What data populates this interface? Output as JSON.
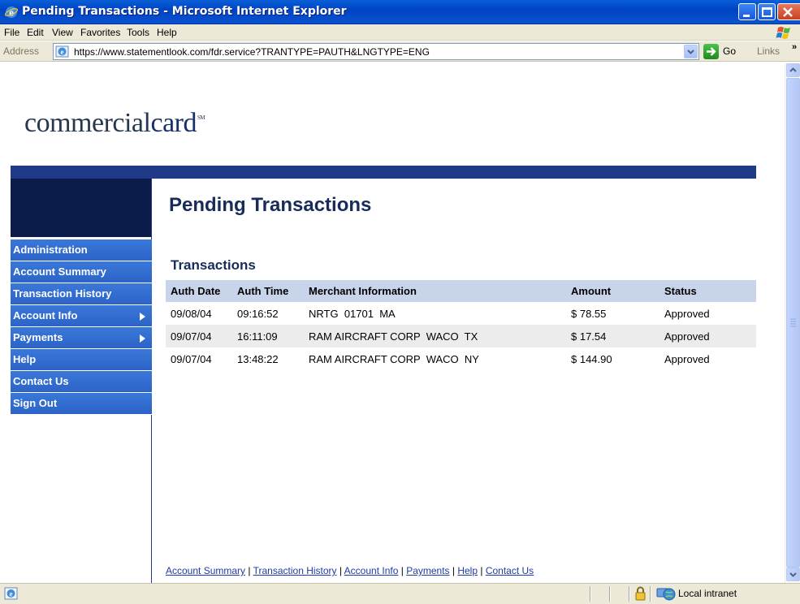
{
  "window": {
    "title": "Pending Transactions - Microsoft Internet Explorer"
  },
  "menu": {
    "file": "File",
    "edit": "Edit",
    "view": "View",
    "favorites": "Favorites",
    "tools": "Tools",
    "help": "Help"
  },
  "address_bar": {
    "label": "Address",
    "url": "https://www.statementlook.com/fdr.service?TRANTYPE=PAUTH&LNGTYPE=ENG",
    "go_label": "Go",
    "links_label": "Links",
    "links_chevron": "»"
  },
  "page": {
    "logo_part1": "commercial",
    "logo_part2": "card",
    "logo_mark": "SM",
    "title": "Pending Transactions",
    "section_title": "Transactions"
  },
  "sidenav": {
    "items": [
      {
        "label": "Administration",
        "has_submenu": false
      },
      {
        "label": "Account Summary",
        "has_submenu": false
      },
      {
        "label": "Transaction History",
        "has_submenu": false
      },
      {
        "label": "Account Info",
        "has_submenu": true
      },
      {
        "label": "Payments",
        "has_submenu": true
      },
      {
        "label": "Help",
        "has_submenu": false
      },
      {
        "label": "Contact Us",
        "has_submenu": false
      },
      {
        "label": "Sign Out",
        "has_submenu": false
      }
    ]
  },
  "transactions": {
    "columns": [
      "Auth Date",
      "Auth Time",
      "Merchant Information",
      "Amount",
      "Status"
    ],
    "rows": [
      [
        "09/08/04",
        "09:16:52",
        "NRTG  01701  MA",
        "$ 78.55",
        "Approved"
      ],
      [
        "09/07/04",
        "16:11:09",
        "RAM AIRCRAFT CORP  WACO  TX",
        "$ 17.54",
        "Approved"
      ],
      [
        "09/07/04",
        "13:48:22",
        "RAM AIRCRAFT CORP  WACO  NY",
        "$ 144.90",
        "Approved"
      ]
    ]
  },
  "footer": {
    "links": [
      "Account Summary",
      "Transaction History",
      "Account Info",
      "Payments",
      "Help",
      "Contact Us"
    ],
    "separator": " | "
  },
  "statusbar": {
    "zone": "Local intranet"
  },
  "colors": {
    "titlebar": "#0a52d0",
    "nav_blue": "#2c63c8",
    "header_band": "#1f3a88",
    "nav_dark": "#0b1c4b",
    "table_header": "#c8d4ea",
    "row_alt": "#ececec"
  },
  "icons": {
    "title_icon": "ie-icon",
    "page_icon": "ie-page-icon",
    "lock": "padlock-icon",
    "zone": "globe-intranet-icon"
  }
}
